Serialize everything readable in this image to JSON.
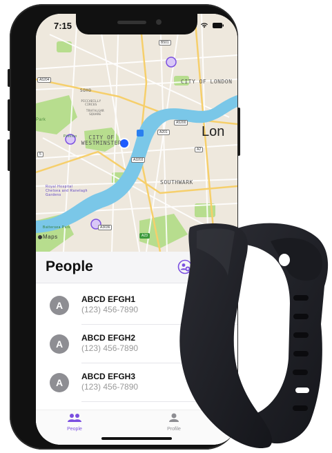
{
  "status": {
    "time": "7:15"
  },
  "map": {
    "labels": {
      "city_of_london": "CITY OF LONDON",
      "soho": "SOHO",
      "city_of_westminster": "CITY OF WESTMINSTER",
      "southwark": "SOUTHWARK",
      "lon": "Lon",
      "royal_hospital": "Royal Hospital Chelsea and Ranelagh Gardens",
      "battersea": "Battersea Park",
      "piccadilly": "PICCADILLY CIRCUS",
      "trafalgar": "TRAFALGAR SQUARE",
      "park": "Park",
      "pimlico": "Pimlico"
    },
    "roads": {
      "b501": "B501",
      "a5204": "A5204",
      "a5200": "A5200",
      "a201": "A201",
      "a2": "A2",
      "a3203": "A3203",
      "a3036": "A3036",
      "a23": "A23",
      "a5": "5"
    },
    "attribution": "Maps"
  },
  "people": {
    "title": "People",
    "items": [
      {
        "initial": "A",
        "name": "ABCD EFGH1",
        "phone": "(123) 456-7890"
      },
      {
        "initial": "A",
        "name": "ABCD EFGH2",
        "phone": "(123) 456-7890"
      },
      {
        "initial": "A",
        "name": "ABCD EFGH3",
        "phone": "(123) 456-7890"
      }
    ]
  },
  "tabs": [
    {
      "label": "People",
      "active": true
    },
    {
      "label": "Profile",
      "active": false
    }
  ],
  "colors": {
    "accent": "#7b4fe0",
    "water": "#7ac7e8",
    "park": "#b7dd8e",
    "map_bg": "#eee8dd",
    "band": "#1b1c22"
  }
}
